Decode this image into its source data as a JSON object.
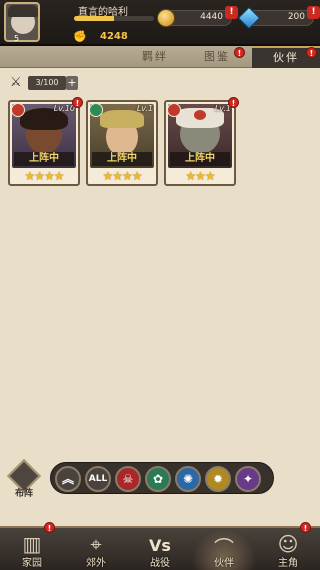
{
  "player": {
    "name": "直言的哈利",
    "level": "5",
    "xp_fraction": 0.5,
    "power": "4248"
  },
  "currencies": {
    "gold": "4440",
    "gems": "200",
    "plus": "!"
  },
  "tabs": [
    {
      "label": "羁绊",
      "active": false
    },
    {
      "label": "图鉴",
      "active": false
    },
    {
      "label": "伙伴",
      "active": true
    }
  ],
  "collection": {
    "count": "3/100",
    "plus": "+"
  },
  "cards": [
    {
      "level": "Lv.10",
      "status": "上阵中",
      "stars": 4,
      "stars_text": "★★★★",
      "role_color": "#c0392b"
    },
    {
      "level": "Lv.1",
      "status": "上阵中",
      "stars": 4,
      "stars_text": "★★★★",
      "role_color": "#2e8b57"
    },
    {
      "level": "Lv.1",
      "status": "上阵中",
      "stars": 3,
      "stars_text": "★★★",
      "role_color": "#c0392b"
    }
  ],
  "alert": "!",
  "filters": {
    "up": "︽",
    "all": "ALL"
  },
  "hire": {
    "label": "布阵"
  },
  "nav": [
    {
      "label": "家园",
      "icon": "building-icon"
    },
    {
      "label": "郊外",
      "icon": "telescope-icon"
    },
    {
      "label": "战役",
      "icon": "vs-icon"
    },
    {
      "label": "伙伴",
      "icon": "hat-icon"
    },
    {
      "label": "主角",
      "icon": "character-icon"
    }
  ],
  "colors": {
    "accent_gold": "#f2c64d",
    "alert_red": "#d0281f",
    "background": "#e9dfc9"
  }
}
